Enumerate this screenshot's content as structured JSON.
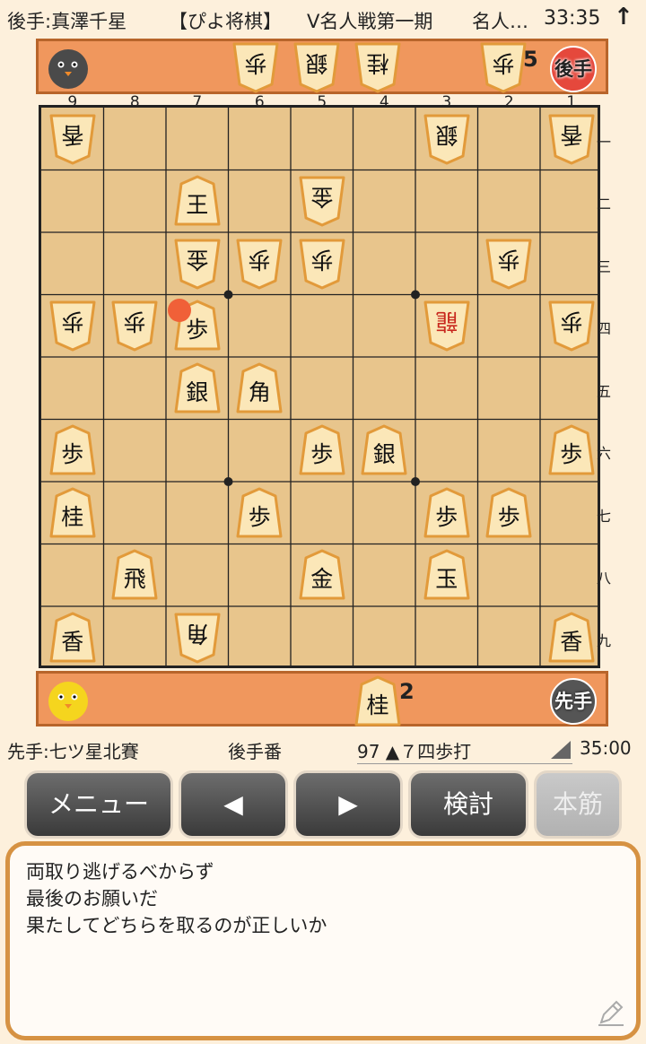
{
  "header": {
    "gote_player": "後手:真澤千星",
    "app_title": "【ぴよ将棋】",
    "event": "V名人戦第一期",
    "event_tail": "名人…",
    "clock": "33:35",
    "up_arrow": "↑"
  },
  "gote_hand": {
    "pieces": [
      "歩",
      "銀",
      "桂",
      "歩"
    ],
    "pawn_count": "5",
    "badge": "後手"
  },
  "column_numbers": [
    "9",
    "8",
    "7",
    "6",
    "5",
    "4",
    "3",
    "2",
    "1"
  ],
  "row_numbers": [
    "一",
    "二",
    "三",
    "四",
    "五",
    "六",
    "七",
    "八",
    "九"
  ],
  "board": [
    {
      "file": 9,
      "rank": 1,
      "ch": "香",
      "side": "gote"
    },
    {
      "file": 3,
      "rank": 1,
      "ch": "銀",
      "side": "gote"
    },
    {
      "file": 1,
      "rank": 1,
      "ch": "香",
      "side": "gote"
    },
    {
      "file": 7,
      "rank": 2,
      "ch": "王",
      "side": "sente"
    },
    {
      "file": 5,
      "rank": 2,
      "ch": "金",
      "side": "gote"
    },
    {
      "file": 7,
      "rank": 3,
      "ch": "金",
      "side": "gote"
    },
    {
      "file": 6,
      "rank": 3,
      "ch": "歩",
      "side": "gote"
    },
    {
      "file": 5,
      "rank": 3,
      "ch": "歩",
      "side": "gote"
    },
    {
      "file": 2,
      "rank": 3,
      "ch": "歩",
      "side": "gote"
    },
    {
      "file": 9,
      "rank": 4,
      "ch": "歩",
      "side": "gote"
    },
    {
      "file": 8,
      "rank": 4,
      "ch": "歩",
      "side": "gote"
    },
    {
      "file": 7,
      "rank": 4,
      "ch": "歩",
      "side": "sente"
    },
    {
      "file": 3,
      "rank": 4,
      "ch": "龍",
      "side": "gote",
      "promoted": true
    },
    {
      "file": 1,
      "rank": 4,
      "ch": "歩",
      "side": "gote"
    },
    {
      "file": 7,
      "rank": 5,
      "ch": "銀",
      "side": "sente"
    },
    {
      "file": 6,
      "rank": 5,
      "ch": "角",
      "side": "sente"
    },
    {
      "file": 9,
      "rank": 6,
      "ch": "歩",
      "side": "sente"
    },
    {
      "file": 5,
      "rank": 6,
      "ch": "歩",
      "side": "sente"
    },
    {
      "file": 4,
      "rank": 6,
      "ch": "銀",
      "side": "sente"
    },
    {
      "file": 1,
      "rank": 6,
      "ch": "歩",
      "side": "sente"
    },
    {
      "file": 9,
      "rank": 7,
      "ch": "桂",
      "side": "sente"
    },
    {
      "file": 6,
      "rank": 7,
      "ch": "歩",
      "side": "sente"
    },
    {
      "file": 3,
      "rank": 7,
      "ch": "歩",
      "side": "sente"
    },
    {
      "file": 2,
      "rank": 7,
      "ch": "歩",
      "side": "sente"
    },
    {
      "file": 8,
      "rank": 8,
      "ch": "飛",
      "side": "sente"
    },
    {
      "file": 5,
      "rank": 8,
      "ch": "金",
      "side": "sente"
    },
    {
      "file": 3,
      "rank": 8,
      "ch": "玉",
      "side": "sente"
    },
    {
      "file": 9,
      "rank": 9,
      "ch": "香",
      "side": "sente"
    },
    {
      "file": 7,
      "rank": 9,
      "ch": "角",
      "side": "gote"
    },
    {
      "file": 1,
      "rank": 9,
      "ch": "香",
      "side": "sente"
    }
  ],
  "last_move_square": {
    "file": 7,
    "rank": 4
  },
  "sente_hand": {
    "pieces": [
      "桂"
    ],
    "knight_count": "2",
    "badge": "先手"
  },
  "status": {
    "sente_player": "先手:七ツ星北賽",
    "turn": "後手番",
    "move": "97 ▲７四歩打",
    "clock": "35:00"
  },
  "buttons": {
    "menu": "メニュー",
    "prev": "◀",
    "next": "▶",
    "analyze": "検討",
    "mainline": "本筋"
  },
  "comment": {
    "lines": [
      "両取り逃げるべからず",
      "最後のお願いだ",
      "果たしてどちらを取るのが正しいか"
    ]
  },
  "colors": {
    "board": "#e8c58c",
    "hand_bar": "#f0975d",
    "piece": "#fbe7b8",
    "promoted_text": "#c8281e",
    "comment_border": "#d69243"
  }
}
